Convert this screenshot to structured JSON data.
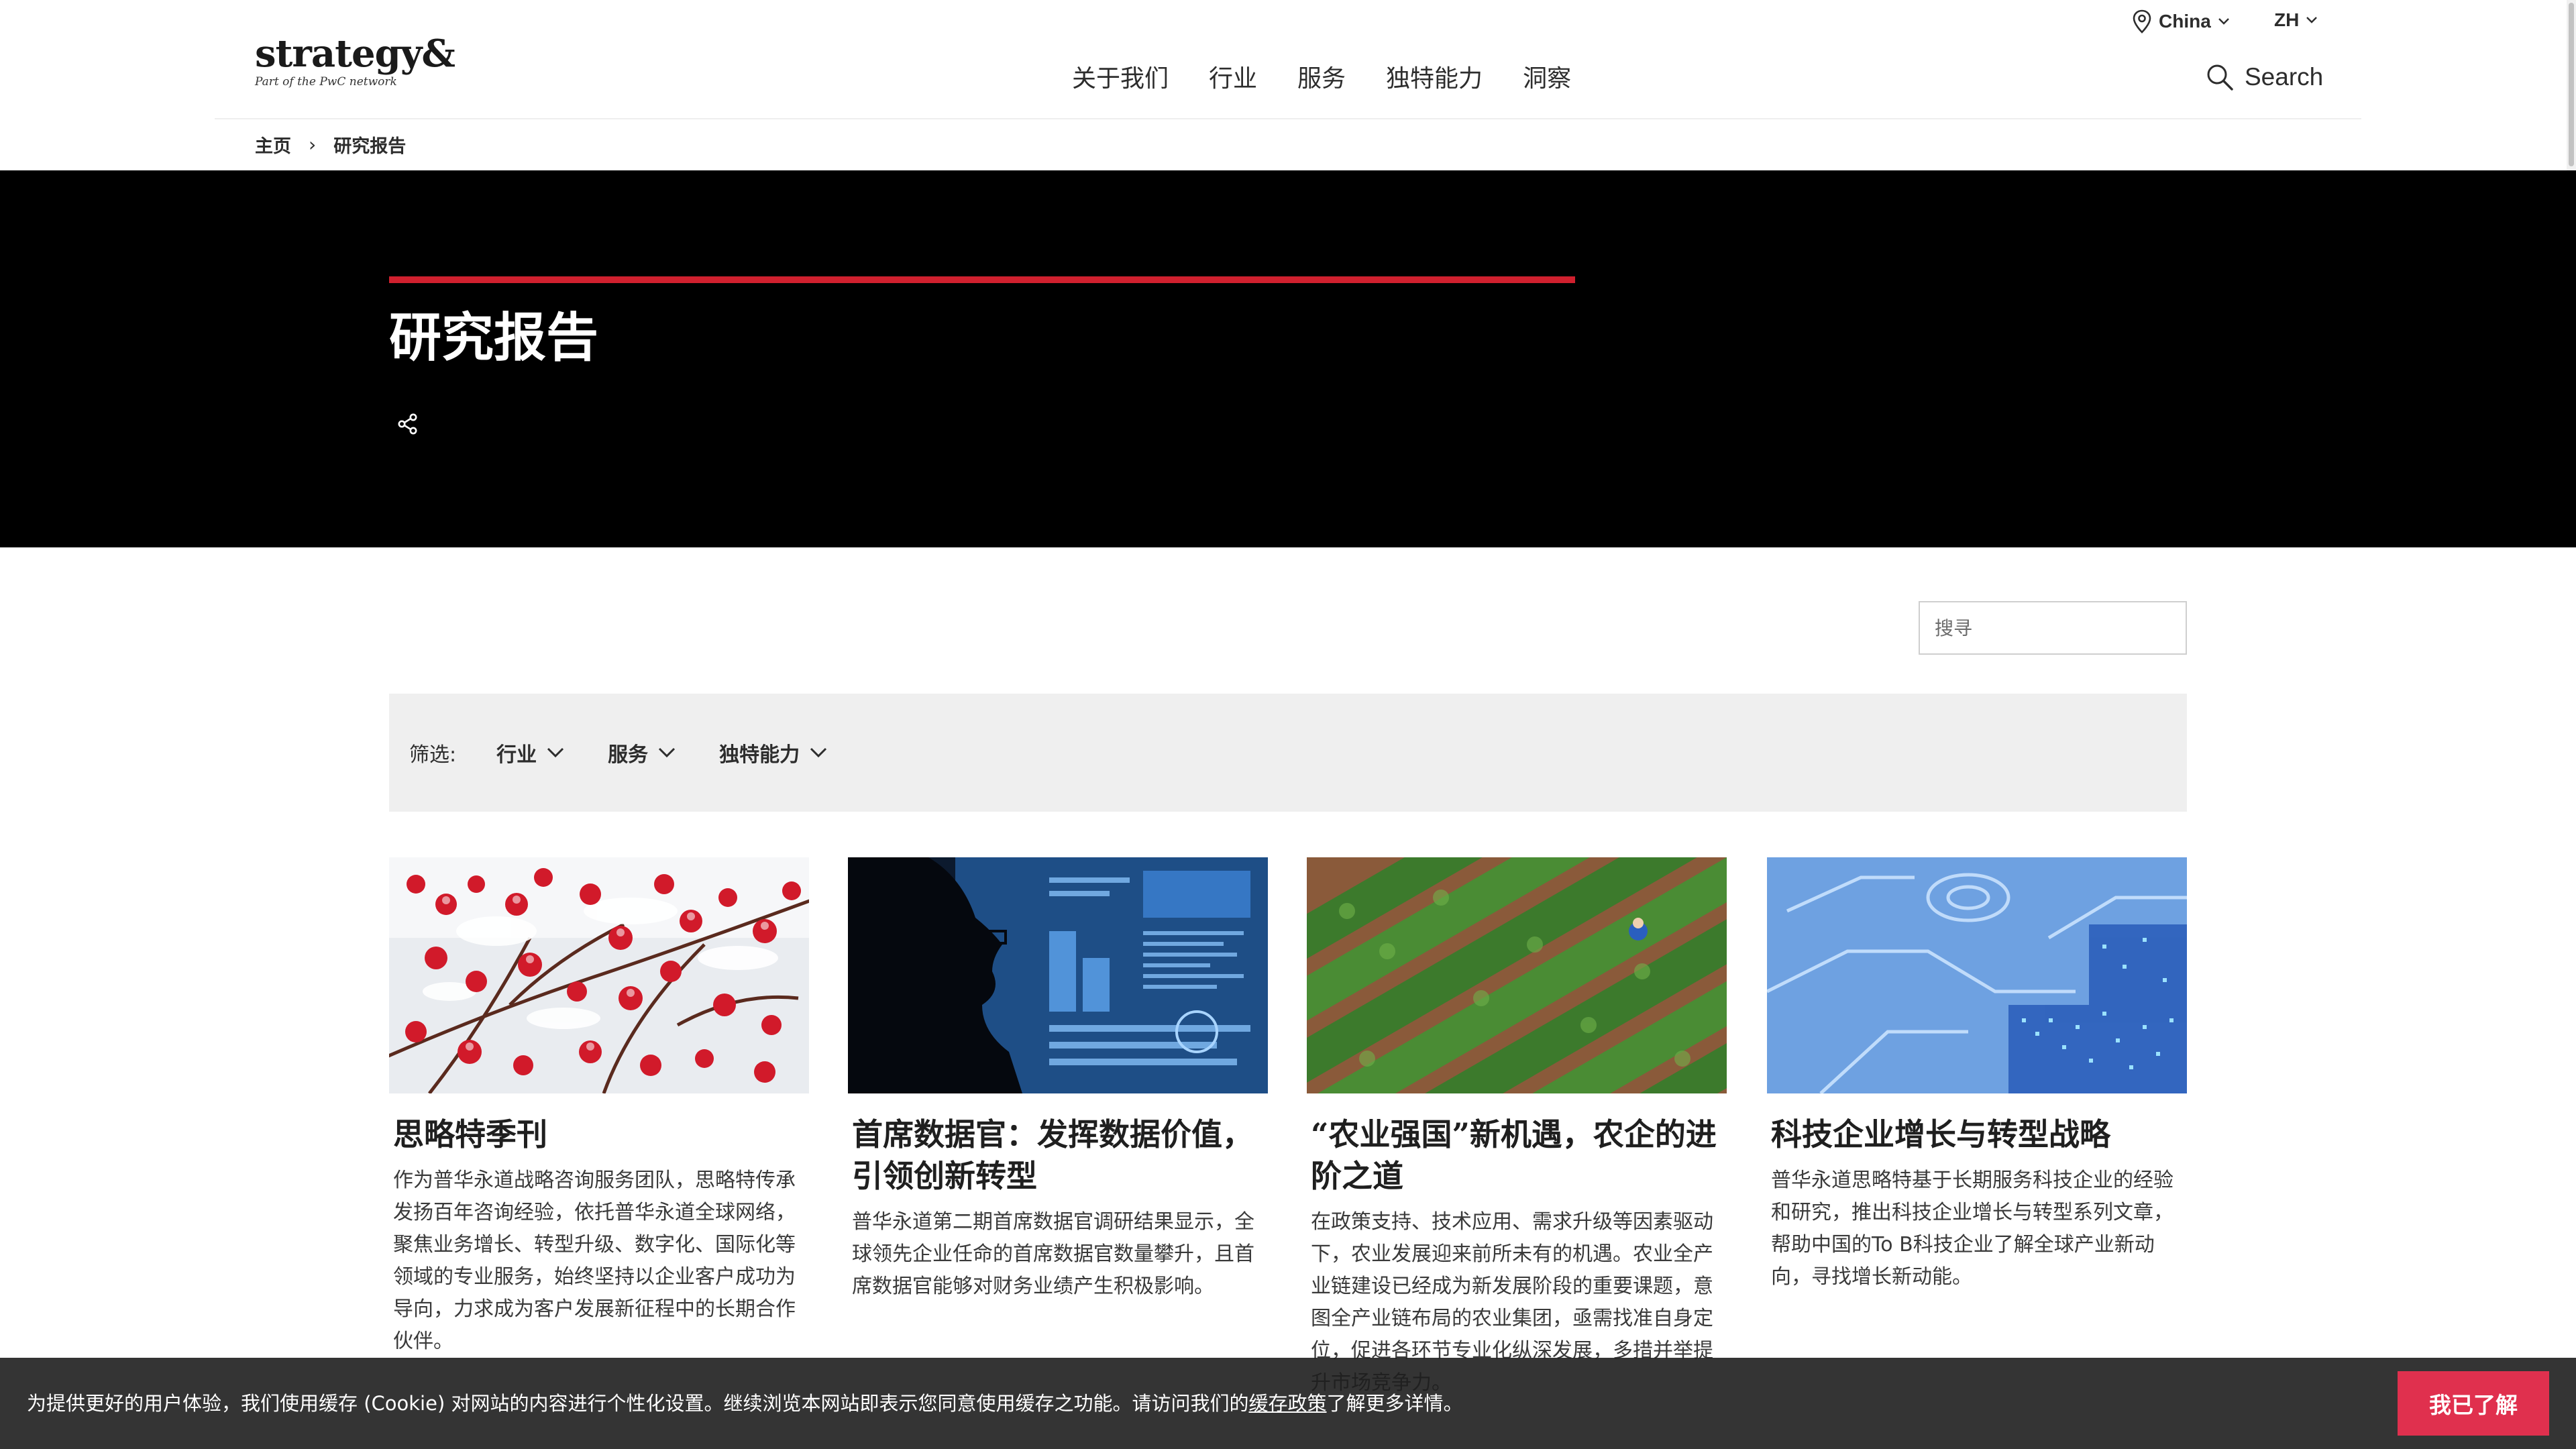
{
  "header": {
    "logo_word": "strategy&",
    "logo_tag": "Part of the PwC network",
    "country": "China",
    "language": "ZH",
    "nav": [
      "关于我们",
      "行业",
      "服务",
      "独特能力",
      "洞察"
    ],
    "search_label": "Search"
  },
  "breadcrumb": {
    "home": "主页",
    "separator": "›",
    "current": "研究报告"
  },
  "hero": {
    "title": "研究报告",
    "accent_color": "#d0202e",
    "share_icon": "share-icon"
  },
  "search": {
    "placeholder": "搜寻"
  },
  "filters": {
    "label": "筛选:",
    "items": [
      "行业",
      "服务",
      "独特能力"
    ]
  },
  "cards": [
    {
      "title": "思略特季刊",
      "description": "作为普华永道战略咨询服务团队，思略特传承发扬百年咨询经验，依托普华永道全球网络，聚焦业务增长、转型升级、数字化、国际化等领域的专业服务，始终坚持以企业客户成功为导向，力求成为客户发展新征程中的长期合作伙伴。",
      "image": "red-berries-in-snow"
    },
    {
      "title": "首席数据官：发挥数据价值，引领创新转型",
      "description": "普华永道第二期首席数据官调研结果显示，全球领先企业任命的首席数据官数量攀升，且首席数据官能够对财务业绩产生积极影响。",
      "image": "woman-silhouette-data-screens"
    },
    {
      "title": "“农业强国”新机遇，农企的进阶之道",
      "description": "在政策支持、技术应用、需求升级等因素驱动下，农业发展迎来前所未有的机遇。农业全产业链建设已经成为新发展阶段的重要课题，意图全产业链布局的农业集团，亟需找准自身定位，促进各环节专业化纵深发展，多措并举提升市场竞争力。",
      "image": "aerial-crop-rows"
    },
    {
      "title": "科技企业增长与转型战略",
      "description": "普华永道思略特基于长期服务科技企业的经验和研究，推出科技企业增长与转型系列文章，帮助中国的To B科技企业了解全球产业新动向，寻找增长新动能。",
      "image": "blue-circuit-board"
    }
  ],
  "cookie": {
    "text_before": "为提供更好的用户体验，我们使用缓存 (Cookie) 对网站的内容进行个性化设置。继续浏览本网站即表示您同意使用缓存之功能。请访问我们的",
    "link": "缓存政策",
    "text_after": "了解更多详情。",
    "button": "我已了解",
    "button_color": "#e0304e"
  }
}
